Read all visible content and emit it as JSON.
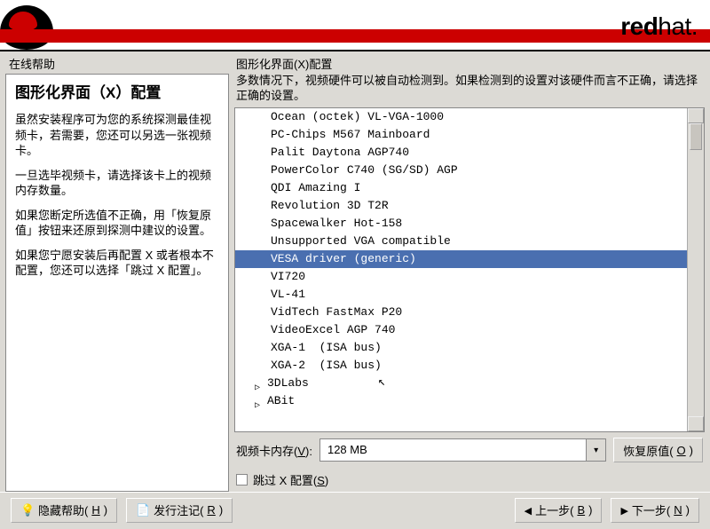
{
  "brand": {
    "bold": "red",
    "light": "hat."
  },
  "sidebar": {
    "title": "在线帮助",
    "heading": "图形化界面（X）配置",
    "paragraphs": [
      "虽然安装程序可为您的系统探测最佳视频卡，若需要，您还可以另选一张视频卡。",
      "一旦选毕视频卡，请选择该卡上的视频内存数量。",
      "如果您断定所选值不正确，用「恢复原值」按钮来还原到探测中建议的设置。",
      "如果您宁愿安装后再配置 X 或者根本不配置，您还可以选择「跳过 X 配置」。"
    ]
  },
  "content": {
    "title": "图形化界面(X)配置",
    "desc": "多数情况下，视频硬件可以被自动检测到。如果检测到的设置对该硬件而言不正确，请选择正确的设置。",
    "list": [
      {
        "label": "Ocean (octek) VL-VGA-1000",
        "level": 2,
        "sel": false
      },
      {
        "label": "PC-Chips M567 Mainboard",
        "level": 2,
        "sel": false
      },
      {
        "label": "Palit Daytona AGP740",
        "level": 2,
        "sel": false
      },
      {
        "label": "PowerColor C740 (SG/SD) AGP",
        "level": 2,
        "sel": false
      },
      {
        "label": "QDI Amazing I",
        "level": 2,
        "sel": false
      },
      {
        "label": "Revolution 3D T2R",
        "level": 2,
        "sel": false
      },
      {
        "label": "Spacewalker Hot-158",
        "level": 2,
        "sel": false
      },
      {
        "label": "Unsupported VGA compatible",
        "level": 2,
        "sel": false
      },
      {
        "label": "VESA driver (generic)",
        "level": 2,
        "sel": true
      },
      {
        "label": "VI720",
        "level": 2,
        "sel": false
      },
      {
        "label": "VL-41",
        "level": 2,
        "sel": false
      },
      {
        "label": "VidTech FastMax P20",
        "level": 2,
        "sel": false
      },
      {
        "label": "VideoExcel AGP 740",
        "level": 2,
        "sel": false
      },
      {
        "label": "XGA-1  (ISA bus)",
        "level": 2,
        "sel": false
      },
      {
        "label": "XGA-2  (ISA bus)",
        "level": 2,
        "sel": false
      },
      {
        "label": "3DLabs",
        "level": 1,
        "sel": false,
        "expandable": true
      },
      {
        "label": "ABit",
        "level": 1,
        "sel": false,
        "expandable": true
      }
    ],
    "memory": {
      "label_pre": "视频卡内存(",
      "label_key": "V",
      "label_post": "):",
      "value": "128 MB"
    },
    "restore": {
      "label_pre": "恢复原值(",
      "label_key": "O",
      "label_post": ")"
    },
    "skip": {
      "label_pre": "跳过 X 配置(",
      "label_key": "S",
      "label_post": ")"
    }
  },
  "footer": {
    "hidehelp": {
      "label_pre": "隐藏帮助(",
      "label_key": "H",
      "label_post": ")"
    },
    "relnotes": {
      "label_pre": "发行注记(",
      "label_key": "R",
      "label_post": ")"
    },
    "back": {
      "label_pre": "上一步(",
      "label_key": "B",
      "label_post": ")"
    },
    "next": {
      "label_pre": "下一步(",
      "label_key": "N",
      "label_post": ")"
    }
  }
}
